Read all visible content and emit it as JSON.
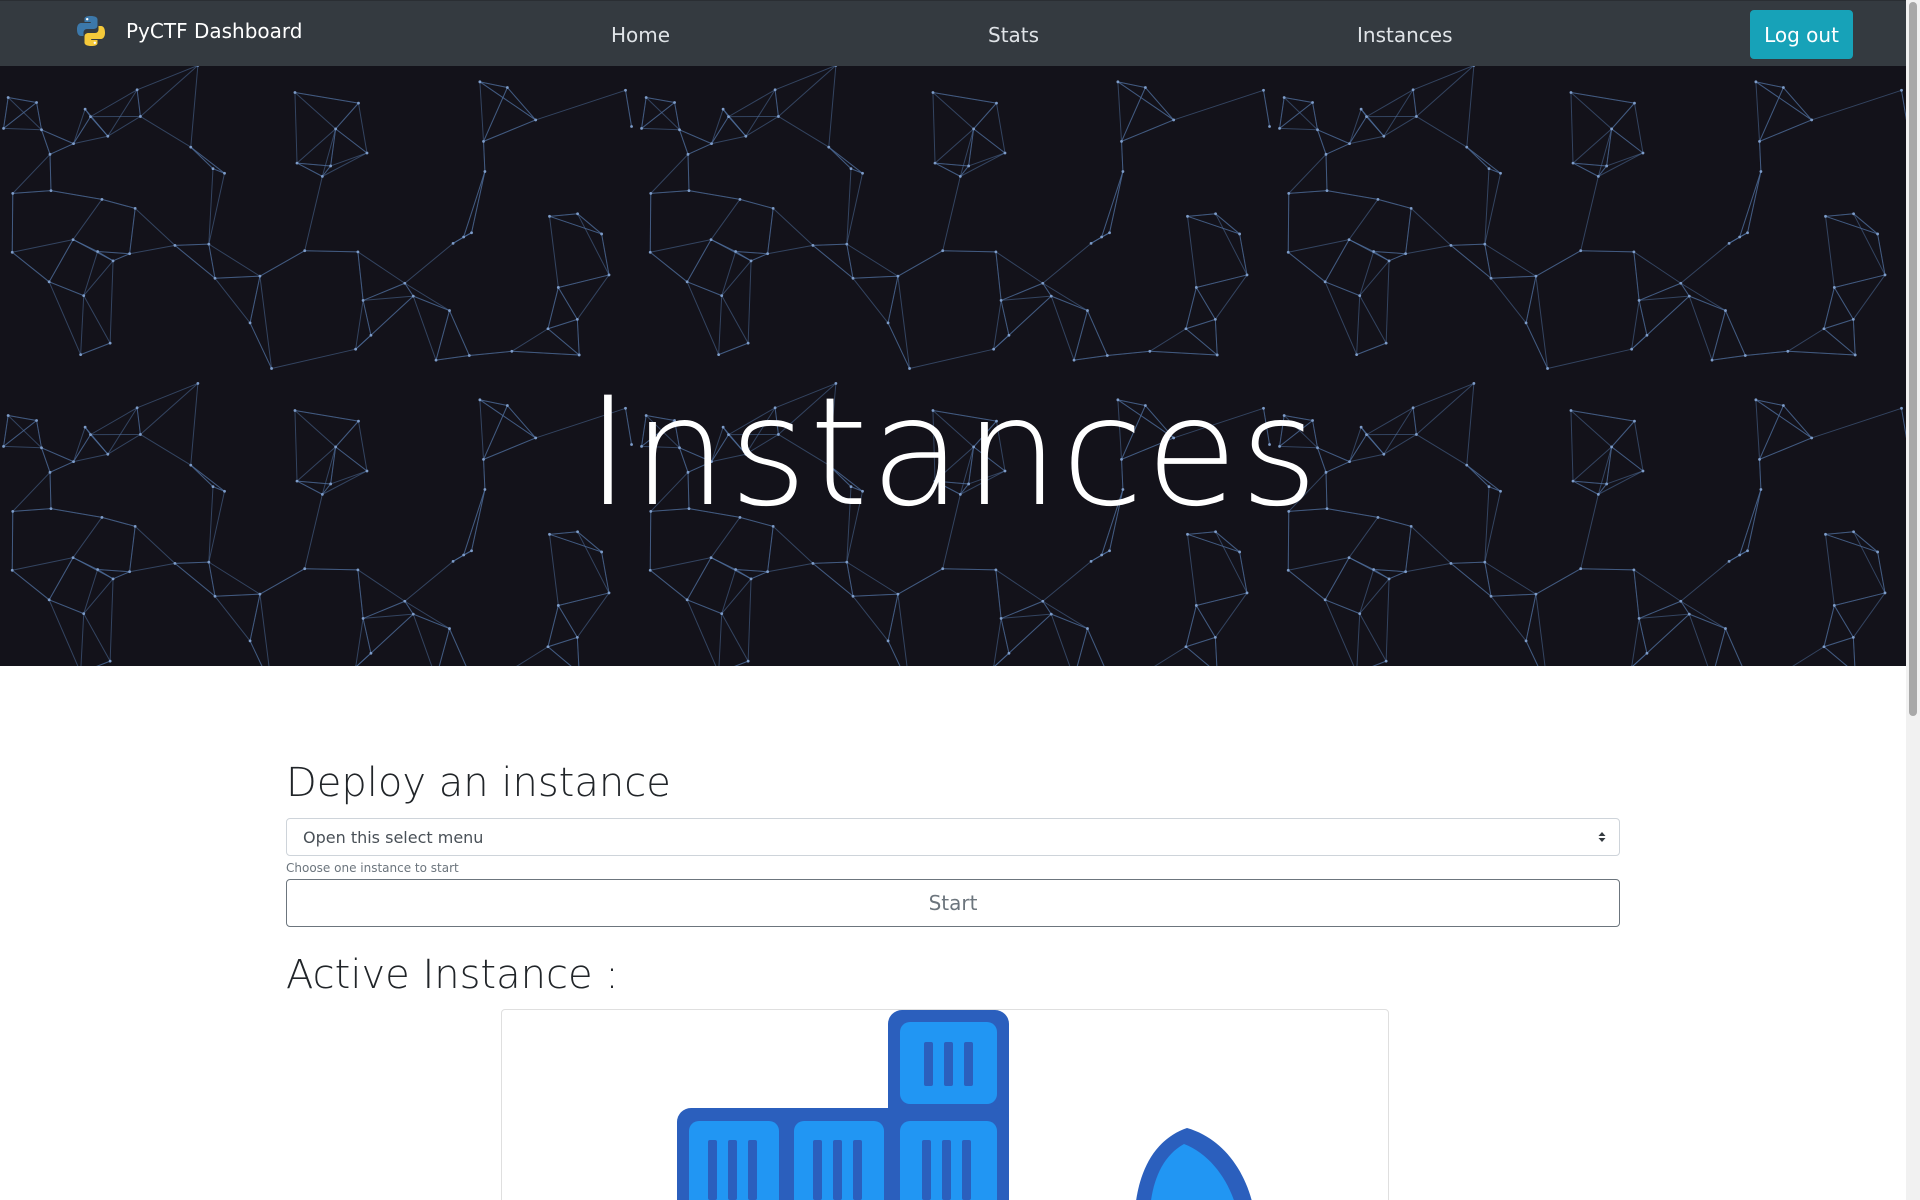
{
  "navbar": {
    "brand": "PyCTF Dashboard",
    "brand_icon": "python-logo-icon",
    "links": [
      "Home",
      "Stats",
      "Instances"
    ],
    "logout_label": "Log out"
  },
  "hero": {
    "title": "Instances"
  },
  "deploy": {
    "heading": "Deploy an instance",
    "select_value": "Open this select menu",
    "help_text": "Choose one instance to start",
    "start_label": "Start"
  },
  "active": {
    "heading": "Active Instance :",
    "image_icon": "docker-container-icon"
  },
  "colors": {
    "navbar_bg": "#343a40",
    "accent": "#17a2b8",
    "hero_bg": "#13121a",
    "container_dark": "#2b5fbd",
    "container_light": "#2196f3"
  }
}
